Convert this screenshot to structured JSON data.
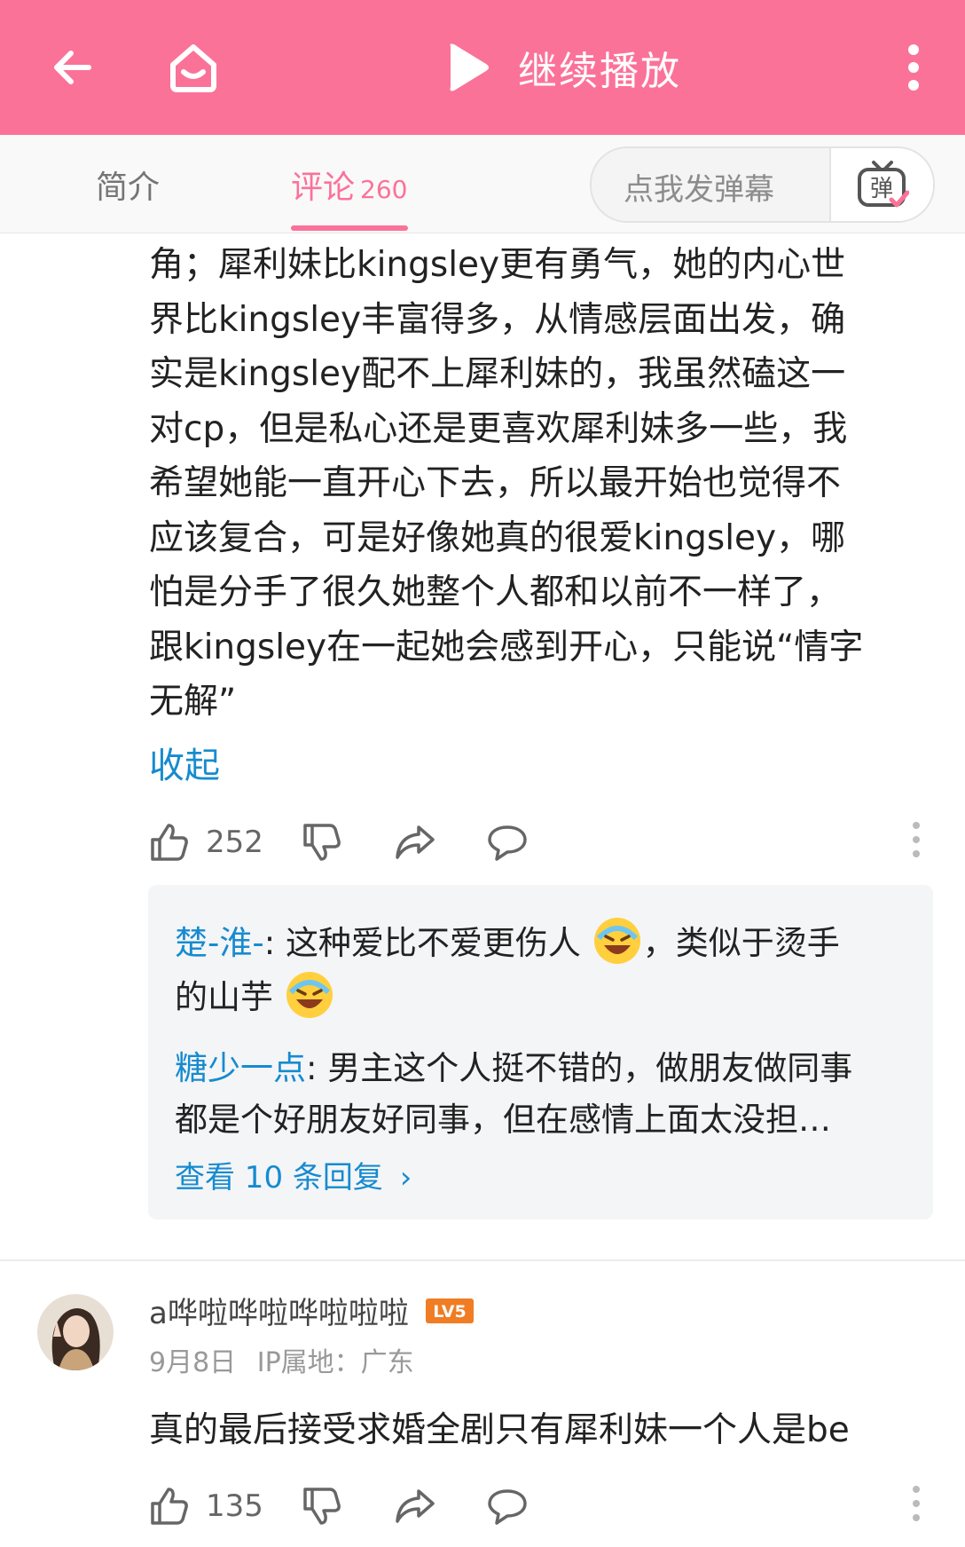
{
  "header": {
    "title": "继续播放",
    "bg_color": "#fb7299",
    "icons": [
      "back-arrow-icon",
      "home-icon",
      "play-icon",
      "more-vertical-icon"
    ]
  },
  "tabs": {
    "intro": "简介",
    "comments": "评论",
    "comments_count": "260",
    "active_color": "#fb7299"
  },
  "danmaku": {
    "placeholder": "点我发弹幕",
    "button_icon": "danmaku-tv-icon",
    "button_text": "弹"
  },
  "comment1": {
    "lines": [
      "角；犀利妹比kingsley更有勇气，她的内心世",
      "界比kingsley丰富得多，从情感层面出发，确",
      "实是kingsley配不上犀利妹的，我虽然磕这一",
      "对cp，但是私心还是更喜欢犀利妹多一些，我",
      "希望她能一直开心下去，所以最开始也觉得不",
      "应该复合，可是好像她真的很爱kingsley，哪",
      "怕是分手了很久她整个人都和以前不一样了，",
      "跟kingsley在一起她会感到开心，只能说“情字",
      "无解”"
    ],
    "collapse": "收起",
    "likes": "252",
    "replies": [
      {
        "user": "楚-淮-",
        "line1": "这种爱比不爱更伤人",
        "line1_tail": "，类似于烫手",
        "line2": "的山芋",
        "emoji": "laugh-cry-emoji"
      },
      {
        "user": "糖少一点",
        "line1": "男主这个人挺不错的，做朋友做同事",
        "line2": "都是个好朋友好同事，但在感情上面太没担…"
      }
    ],
    "view_more": "查看 10 条回复",
    "view_more_arrow": "›"
  },
  "comment2": {
    "username": "a哗啦哗啦哗啦啦啦",
    "level": "LV5",
    "level_color": "#f07c23",
    "date": "9月8日",
    "ip": "IP属地：广东",
    "text": "真的最后接受求婚全剧只有犀利妹一个人是be",
    "likes": "135"
  },
  "link_color": "#178bcf"
}
